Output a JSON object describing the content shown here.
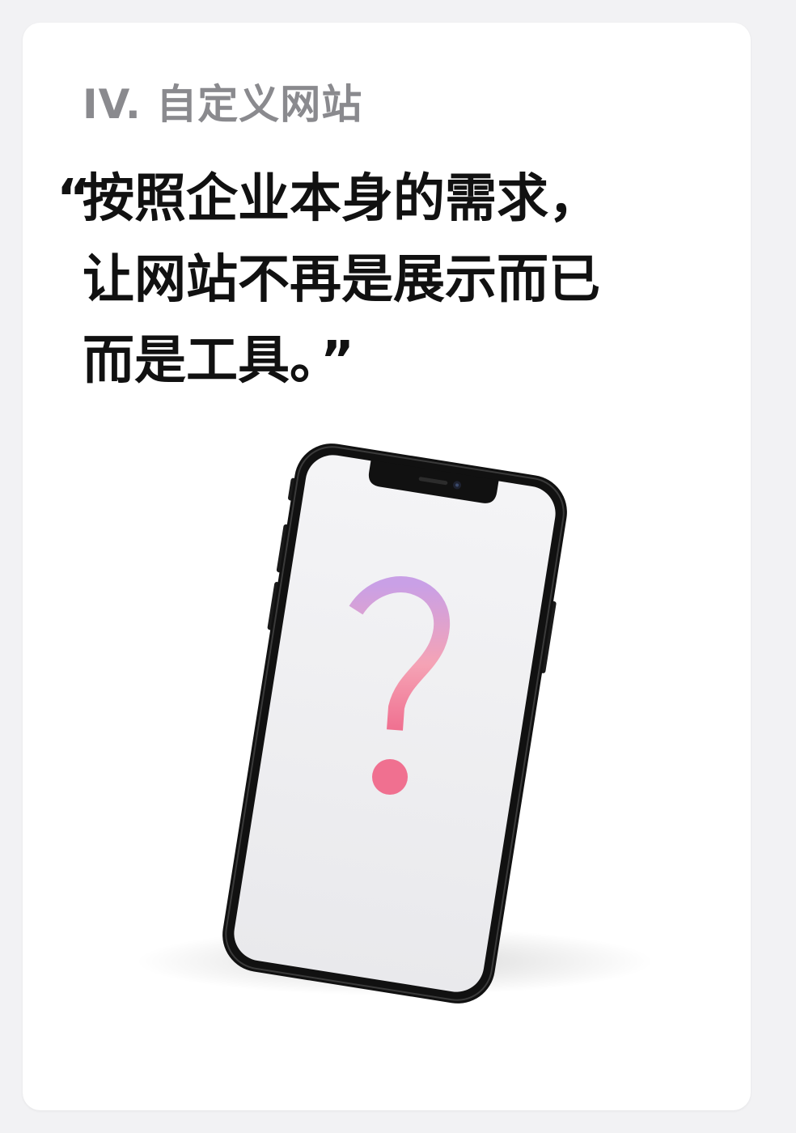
{
  "card": {
    "section_title": "IV. 自定义网站",
    "quote": {
      "open_mark": "“",
      "lines": [
        "按照企业本身的需求，",
        "让网站不再是展示而已",
        "而是工具。"
      ],
      "close_mark": "”"
    }
  },
  "illustration": {
    "icon": "smartphone-icon",
    "screen_symbol": "?",
    "gradient_colors": [
      "#c9a0e6",
      "#f5a3b5",
      "#f07090"
    ]
  }
}
